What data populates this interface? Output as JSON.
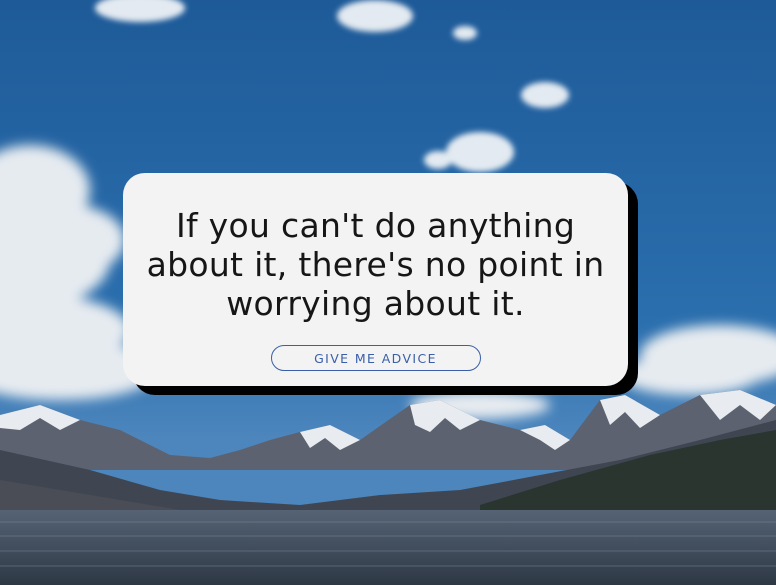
{
  "background": {
    "scene": "mountain-lake-landscape",
    "sky_color": "#1f5c99",
    "water_color": "#3d4a5a"
  },
  "quote": {
    "text": "If you can't do anything about it, there's no point in worrying about it."
  },
  "advice_button": {
    "label": "GIVE ME ADVICE",
    "color": "#3a5fa8"
  },
  "card": {
    "background": "#f3f3f3",
    "shadow": "#000000"
  }
}
